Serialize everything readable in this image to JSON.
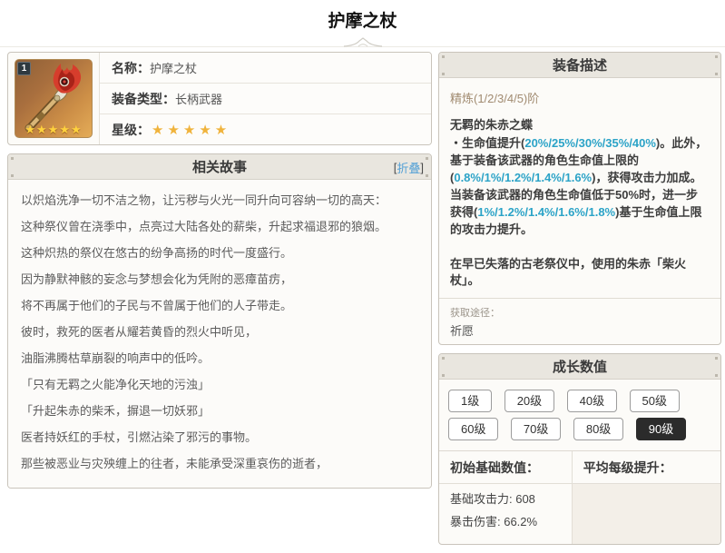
{
  "page": {
    "title": "护摩之杖"
  },
  "info": {
    "badge": "1",
    "thumb_stars": "★★★★★",
    "rows": [
      {
        "label": "名称：",
        "value": "护摩之杖"
      },
      {
        "label": "装备类型：",
        "value": "长柄武器"
      },
      {
        "label": "星级：",
        "value": ""
      }
    ],
    "rarity_stars": "★★★★★"
  },
  "story": {
    "title": "相关故事",
    "collapse_open": "[",
    "collapse_label": "折叠",
    "collapse_close": "]",
    "paragraphs": [
      "以炽焰洗净一切不洁之物，让污秽与火光一同升向可容纳一切的高天：",
      "这种祭仪曾在浇季中，点亮过大陆各处的薪柴，升起求福退邪的狼烟。",
      "这种炽热的祭仪在悠古的纷争高扬的时代一度盛行。",
      "因为静默神骸的妄念与梦想会化为凭附的恶瘴苗疠，",
      "将不再属于他们的子民与不曾属于他们的人子带走。",
      "彼时，救死的医者从耀若黄昏的烈火中听见，",
      "油脂沸腾枯草崩裂的响声中的低吟。",
      "「只有无羁之火能净化天地的污浊」",
      "「升起朱赤的柴禾，摒退一切妖邪」",
      "医者持妖红的手杖，引燃沾染了邪污的事物。",
      "那些被恶业与灾殃缠上的往者，未能承受深重哀伤的逝者，"
    ]
  },
  "desc": {
    "title": "装备描述",
    "refine_label": "精炼(1/2/3/4/5)阶",
    "passive_name": "无羁的朱赤之蝶",
    "passive_segments": [
      {
        "t": "・生命值提升(",
        "c": ""
      },
      {
        "t": "20%/25%/30%/35%/40%",
        "c": "hl"
      },
      {
        "t": ")。此外，基于装备该武器的角色生命值上限的(",
        "c": ""
      },
      {
        "t": "0.8%/1%/1.2%/1.4%/1.6%",
        "c": "hl"
      },
      {
        "t": ")，获得攻击力加成。当装备该武器的角色生命值低于50%时，进一步获得(",
        "c": ""
      },
      {
        "t": "1%/1.2%/1.4%/1.6%/1.8%",
        "c": "hl"
      },
      {
        "t": ")基于生命值上限的攻击力提升。",
        "c": ""
      }
    ],
    "flavor": "在早已失落的古老祭仪中，使用的朱赤「柴火杖」。",
    "source_label": "获取途径：",
    "source_value": "祈愿"
  },
  "growth": {
    "title": "成长数值",
    "levels": [
      "1级",
      "20级",
      "40级",
      "50级",
      "60级",
      "70级",
      "80级",
      "90级"
    ],
    "selected_level": "90级",
    "base_header": "初始基础数值：",
    "avg_header": "平均每级提升：",
    "base_stats": [
      "基础攻击力: 608",
      "暴击伤害: 66.2%"
    ]
  },
  "colors": {
    "accent_teal": "#2ba3c7",
    "star_gold": "#f0b33c",
    "refine_brown": "#a18b71",
    "selected_level_bg": "#2b2b2b",
    "header_bg": "#e9e6df"
  }
}
